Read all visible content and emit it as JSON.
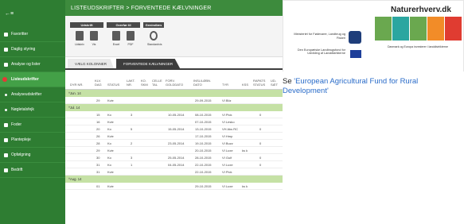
{
  "sidebar": {
    "items": [
      {
        "label": "Favoritter",
        "type": "main",
        "active": false
      },
      {
        "label": "Daglig styring",
        "type": "main",
        "active": false
      },
      {
        "label": "Analyse og lister",
        "type": "main",
        "active": false
      },
      {
        "label": "Listeudskrifter",
        "type": "main",
        "active": true
      },
      {
        "label": "Analyseudskrifter",
        "type": "sub",
        "active": false
      },
      {
        "label": "Nøgletalsfejk",
        "type": "sub",
        "active": false
      },
      {
        "label": "Foder",
        "type": "main",
        "active": false
      },
      {
        "label": "Plantepleje",
        "type": "main",
        "active": false
      },
      {
        "label": "Opfølgning",
        "type": "main",
        "active": false
      },
      {
        "label": "Bedrift",
        "type": "main",
        "active": false
      }
    ],
    "back_icon": "back-arrow-icon"
  },
  "header": {
    "breadcrumb": "LISTEUDSKRIFTER  >  FORVENTEDE KÆLVNINGER"
  },
  "ribbon": {
    "groups": [
      {
        "title": "Udskrift",
        "buttons": [
          {
            "label": "Udskriv",
            "icon": "printer-icon"
          },
          {
            "label": "Vis",
            "icon": "document-icon"
          }
        ]
      },
      {
        "title": "Overfør til",
        "buttons": [
          {
            "label": "Excel",
            "icon": "excel-icon"
          },
          {
            "label": "PDF",
            "icon": "pdf-icon"
          }
        ]
      },
      {
        "title": "Genindlæs",
        "buttons": [
          {
            "label": "Standardvis",
            "icon": "refresh-icon"
          }
        ]
      }
    ]
  },
  "tabs": [
    {
      "label": "VÆLG KOLONNER",
      "active": false
    },
    {
      "label": "FORVENTEDE KÆLVNINGER",
      "active": true
    }
  ],
  "table": {
    "headers": [
      "DYR NR.",
      "KLV. DAG",
      "STATUS",
      "LAKT. NR.",
      "KO. SKM",
      "CELLE TAL",
      "FORV. GOLDDATO",
      "INSL/LØBN. DATO",
      "TYR",
      "KSS",
      "RAPATS STATUS",
      "UD-SÆT"
    ],
    "groups": [
      {
        "label": "Jun. 14",
        "rows": [
          [
            "",
            "29",
            "Kvie",
            "",
            "",
            "",
            "",
            "29-09-2015",
            "VI Blíz",
            "",
            "",
            ""
          ]
        ]
      },
      {
        "label": "Jul. 14",
        "rows": [
          [
            "",
            "15",
            "Ko",
            "3",
            "",
            "",
            "10-05-2014",
            "08-10-2015",
            "VI Pick",
            "",
            "0",
            ""
          ],
          [
            "",
            "16",
            "Kvie",
            "",
            "",
            "",
            "",
            "07-10-2015",
            "VI Lesko",
            "",
            "",
            ""
          ],
          [
            "",
            "20",
            "Ko",
            "5",
            "",
            "",
            "15-05-2014",
            "13-10-2015",
            "VH Aks RC",
            "",
            "0",
            ""
          ],
          [
            "",
            "26",
            "Kvie",
            "",
            "",
            "",
            "",
            "17-10-2015",
            "VI Hmp",
            "",
            "",
            ""
          ],
          [
            "",
            "28",
            "Ko",
            "2",
            "",
            "",
            "23-05-2014",
            "19-10-2015",
            "VI Buzz",
            "",
            "0",
            ""
          ],
          [
            "",
            "29",
            "Kvie",
            "",
            "",
            "",
            "",
            "20-10-2015",
            "VI Luxe",
            "ks k",
            "",
            ""
          ],
          [
            "",
            "30",
            "Ko",
            "3",
            "",
            "",
            "25-05-2014",
            "28-10-2015",
            "VI Gulf",
            "",
            "0",
            ""
          ],
          [
            "",
            "31",
            "Ko",
            "1",
            "",
            "",
            "04-05-2014",
            "22-10-2015",
            "VI Luxe",
            "",
            "0",
            ""
          ],
          [
            "",
            "31",
            "Kvie",
            "",
            "",
            "",
            "",
            "22-10-2015",
            "VI Pick",
            "",
            "",
            ""
          ]
        ]
      },
      {
        "label": "Aug. 14",
        "rows": [
          [
            "",
            "01",
            "Kvie",
            "",
            "",
            "",
            "",
            "29-10-2015",
            "VI Luxe",
            "ks k",
            "",
            ""
          ]
        ]
      }
    ]
  },
  "logo": {
    "left_text_1": "Ministeriet for Fødevarer, Landbrug og Fiskeri",
    "left_text_2": "Den Europæiske Landbrugsfond for Udvikling af Landdistrikterne",
    "brand": "Naturerhverv.dk",
    "strap": "Danmark og Europa investerer i landdistrikterne",
    "colors": {
      "green": "#6aa84f",
      "teal": "#2ba6a0",
      "orange": "#f28c28",
      "red": "#e03c31"
    }
  },
  "caption": {
    "prefix": "Se ",
    "link": "'European Agricultural Fund for Rural Development'"
  },
  "colors": {
    "sidebar": "#2e7d32",
    "header": "#3d8b3d",
    "group_row": "#c5e1a5"
  }
}
